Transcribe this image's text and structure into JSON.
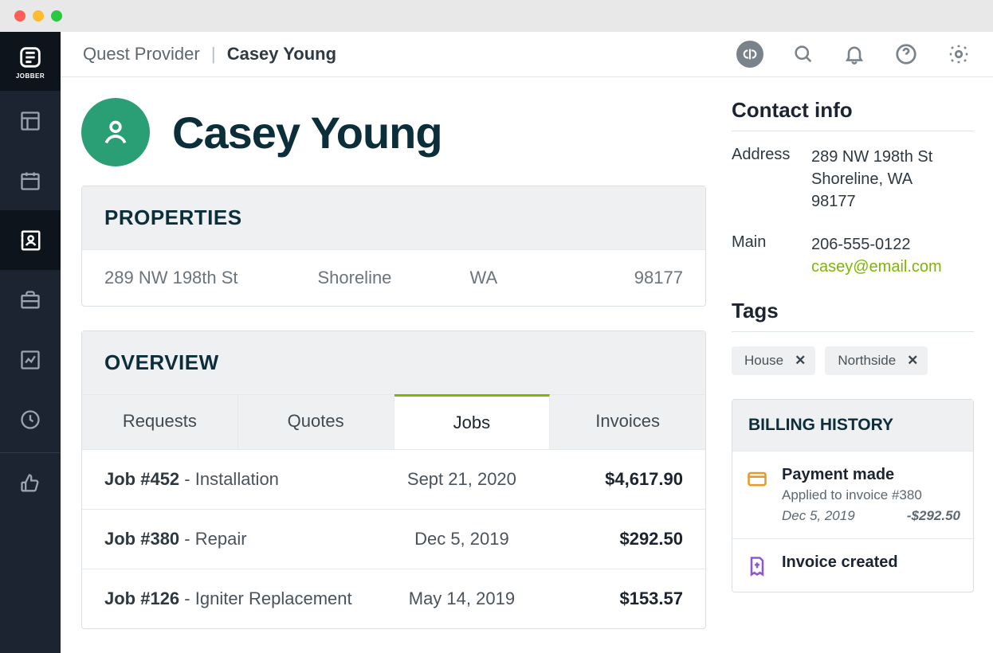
{
  "app": {
    "name": "JOBBER"
  },
  "breadcrumb": {
    "company": "Quest Provider",
    "client": "Casey Young"
  },
  "client": {
    "name": "Casey Young"
  },
  "properties": {
    "title": "PROPERTIES",
    "rows": [
      {
        "street": "289 NW 198th St",
        "city": "Shoreline",
        "state": "WA",
        "zip": "98177"
      }
    ]
  },
  "overview": {
    "title": "OVERVIEW",
    "tabs": [
      "Requests",
      "Quotes",
      "Jobs",
      "Invoices"
    ],
    "active_tab": "Jobs",
    "jobs": [
      {
        "id": "Job #452",
        "desc": "Installation",
        "date": "Sept 21, 2020",
        "amount": "$4,617.90"
      },
      {
        "id": "Job #380",
        "desc": "Repair",
        "date": "Dec 5, 2019",
        "amount": "$292.50"
      },
      {
        "id": "Job #126",
        "desc": "Igniter Replacement",
        "date": "May 14, 2019",
        "amount": "$153.57"
      }
    ]
  },
  "contact": {
    "title": "Contact info",
    "address_label": "Address",
    "address_line1": "289 NW 198th St",
    "address_line2": "Shoreline, WA",
    "address_zip": "98177",
    "main_label": "Main",
    "phone": "206-555-0122",
    "email": "casey@email.com"
  },
  "tags": {
    "title": "Tags",
    "items": [
      "House",
      "Northside"
    ]
  },
  "billing": {
    "title": "BILLING HISTORY",
    "items": [
      {
        "icon": "card",
        "title": "Payment made",
        "sub": "Applied to invoice #380",
        "date": "Dec 5, 2019",
        "amount": "-$292.50"
      },
      {
        "icon": "invoice",
        "title": "Invoice created",
        "sub": "",
        "date": "",
        "amount": ""
      }
    ]
  }
}
